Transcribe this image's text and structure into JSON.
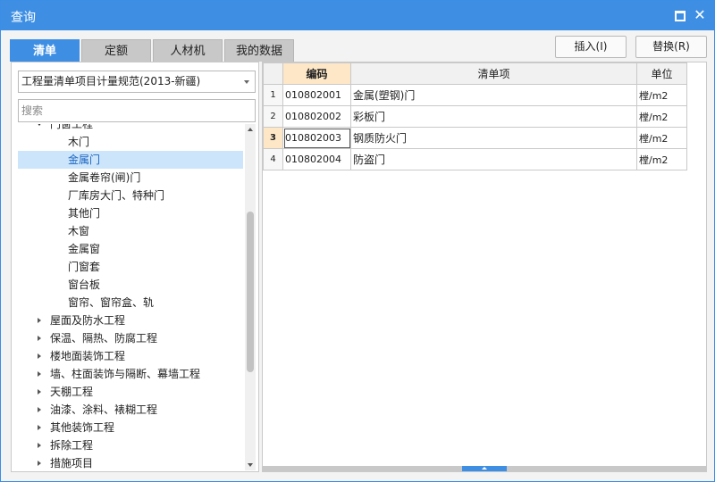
{
  "window": {
    "title": "查询"
  },
  "tabs": [
    {
      "label": "清单",
      "active": true
    },
    {
      "label": "定额",
      "active": false
    },
    {
      "label": "人材机",
      "active": false
    },
    {
      "label": "我的数据",
      "active": false
    }
  ],
  "buttons": {
    "insert": "插入(I)",
    "replace": "替换(R)"
  },
  "left": {
    "spec_select": "工程量清单项目计量规范(2013-新疆)",
    "search_placeholder": "搜索",
    "tree": [
      {
        "label": "门窗工程",
        "level": 1,
        "toggle": "expanded"
      },
      {
        "label": "木门",
        "level": 2
      },
      {
        "label": "金属门",
        "level": 2,
        "selected": true
      },
      {
        "label": "金属卷帘(闸)门",
        "level": 2
      },
      {
        "label": "厂库房大门、特种门",
        "level": 2
      },
      {
        "label": "其他门",
        "level": 2
      },
      {
        "label": "木窗",
        "level": 2
      },
      {
        "label": "金属窗",
        "level": 2
      },
      {
        "label": "门窗套",
        "level": 2
      },
      {
        "label": "窗台板",
        "level": 2
      },
      {
        "label": "窗帘、窗帘盒、轨",
        "level": 2
      },
      {
        "label": "屋面及防水工程",
        "level": 1,
        "toggle": "collapsed"
      },
      {
        "label": "保温、隔热、防腐工程",
        "level": 1,
        "toggle": "collapsed"
      },
      {
        "label": "楼地面装饰工程",
        "level": 1,
        "toggle": "collapsed"
      },
      {
        "label": "墙、柱面装饰与隔断、幕墙工程",
        "level": 1,
        "toggle": "collapsed"
      },
      {
        "label": "天棚工程",
        "level": 1,
        "toggle": "collapsed"
      },
      {
        "label": "油漆、涂料、裱糊工程",
        "level": 1,
        "toggle": "collapsed"
      },
      {
        "label": "其他装饰工程",
        "level": 1,
        "toggle": "collapsed"
      },
      {
        "label": "拆除工程",
        "level": 1,
        "toggle": "collapsed"
      },
      {
        "label": "措施项目",
        "level": 1,
        "toggle": "collapsed"
      }
    ]
  },
  "grid": {
    "headers": {
      "code": "编码",
      "item": "清单项",
      "unit": "单位"
    },
    "rows": [
      {
        "num": "1",
        "code": "010802001",
        "item": "金属(塑钢)门",
        "unit": "樘/m2"
      },
      {
        "num": "2",
        "code": "010802002",
        "item": "彩板门",
        "unit": "樘/m2"
      },
      {
        "num": "3",
        "code": "010802003",
        "item": "钢质防火门",
        "unit": "樘/m2",
        "current": true
      },
      {
        "num": "4",
        "code": "010802004",
        "item": "防盗门",
        "unit": "樘/m2"
      }
    ]
  },
  "icons": {
    "maximize": "maximize-icon",
    "close": "close-icon"
  },
  "colors": {
    "accent": "#3e8fe4",
    "selected_bg": "#cde5fa",
    "current_row": "#fde7c7"
  }
}
